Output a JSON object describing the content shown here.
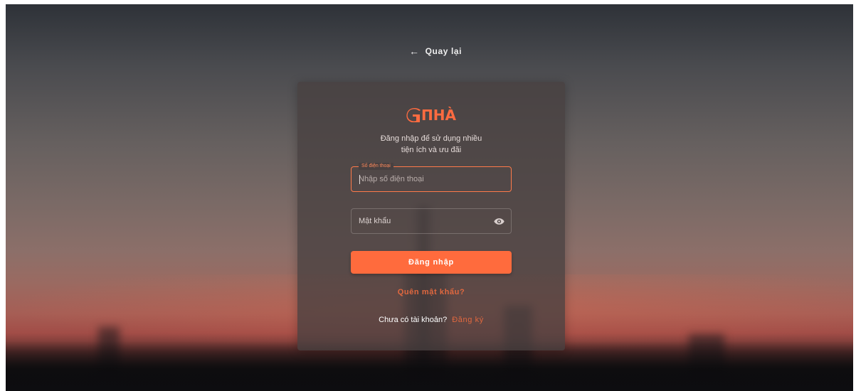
{
  "back": {
    "label": "Quay lại"
  },
  "brand": {
    "logo_text": "ПHÀ",
    "accent_color": "#ff6b3d"
  },
  "subtitle": {
    "line1": "Đăng nhập để sử dụng nhiều",
    "line2": "tiện ích và ưu đãi"
  },
  "phone": {
    "label": "Số điện thoại",
    "placeholder": "Nhập số điện thoại",
    "value": ""
  },
  "password": {
    "placeholder": "Mật khẩu",
    "value": "",
    "toggle_icon": "eye-icon"
  },
  "login_button": {
    "label": "Đăng nhập"
  },
  "forgot": {
    "label": "Quên mật khẩu?"
  },
  "signup": {
    "question": "Chưa có tài khoản?",
    "link": "Đăng ký"
  }
}
